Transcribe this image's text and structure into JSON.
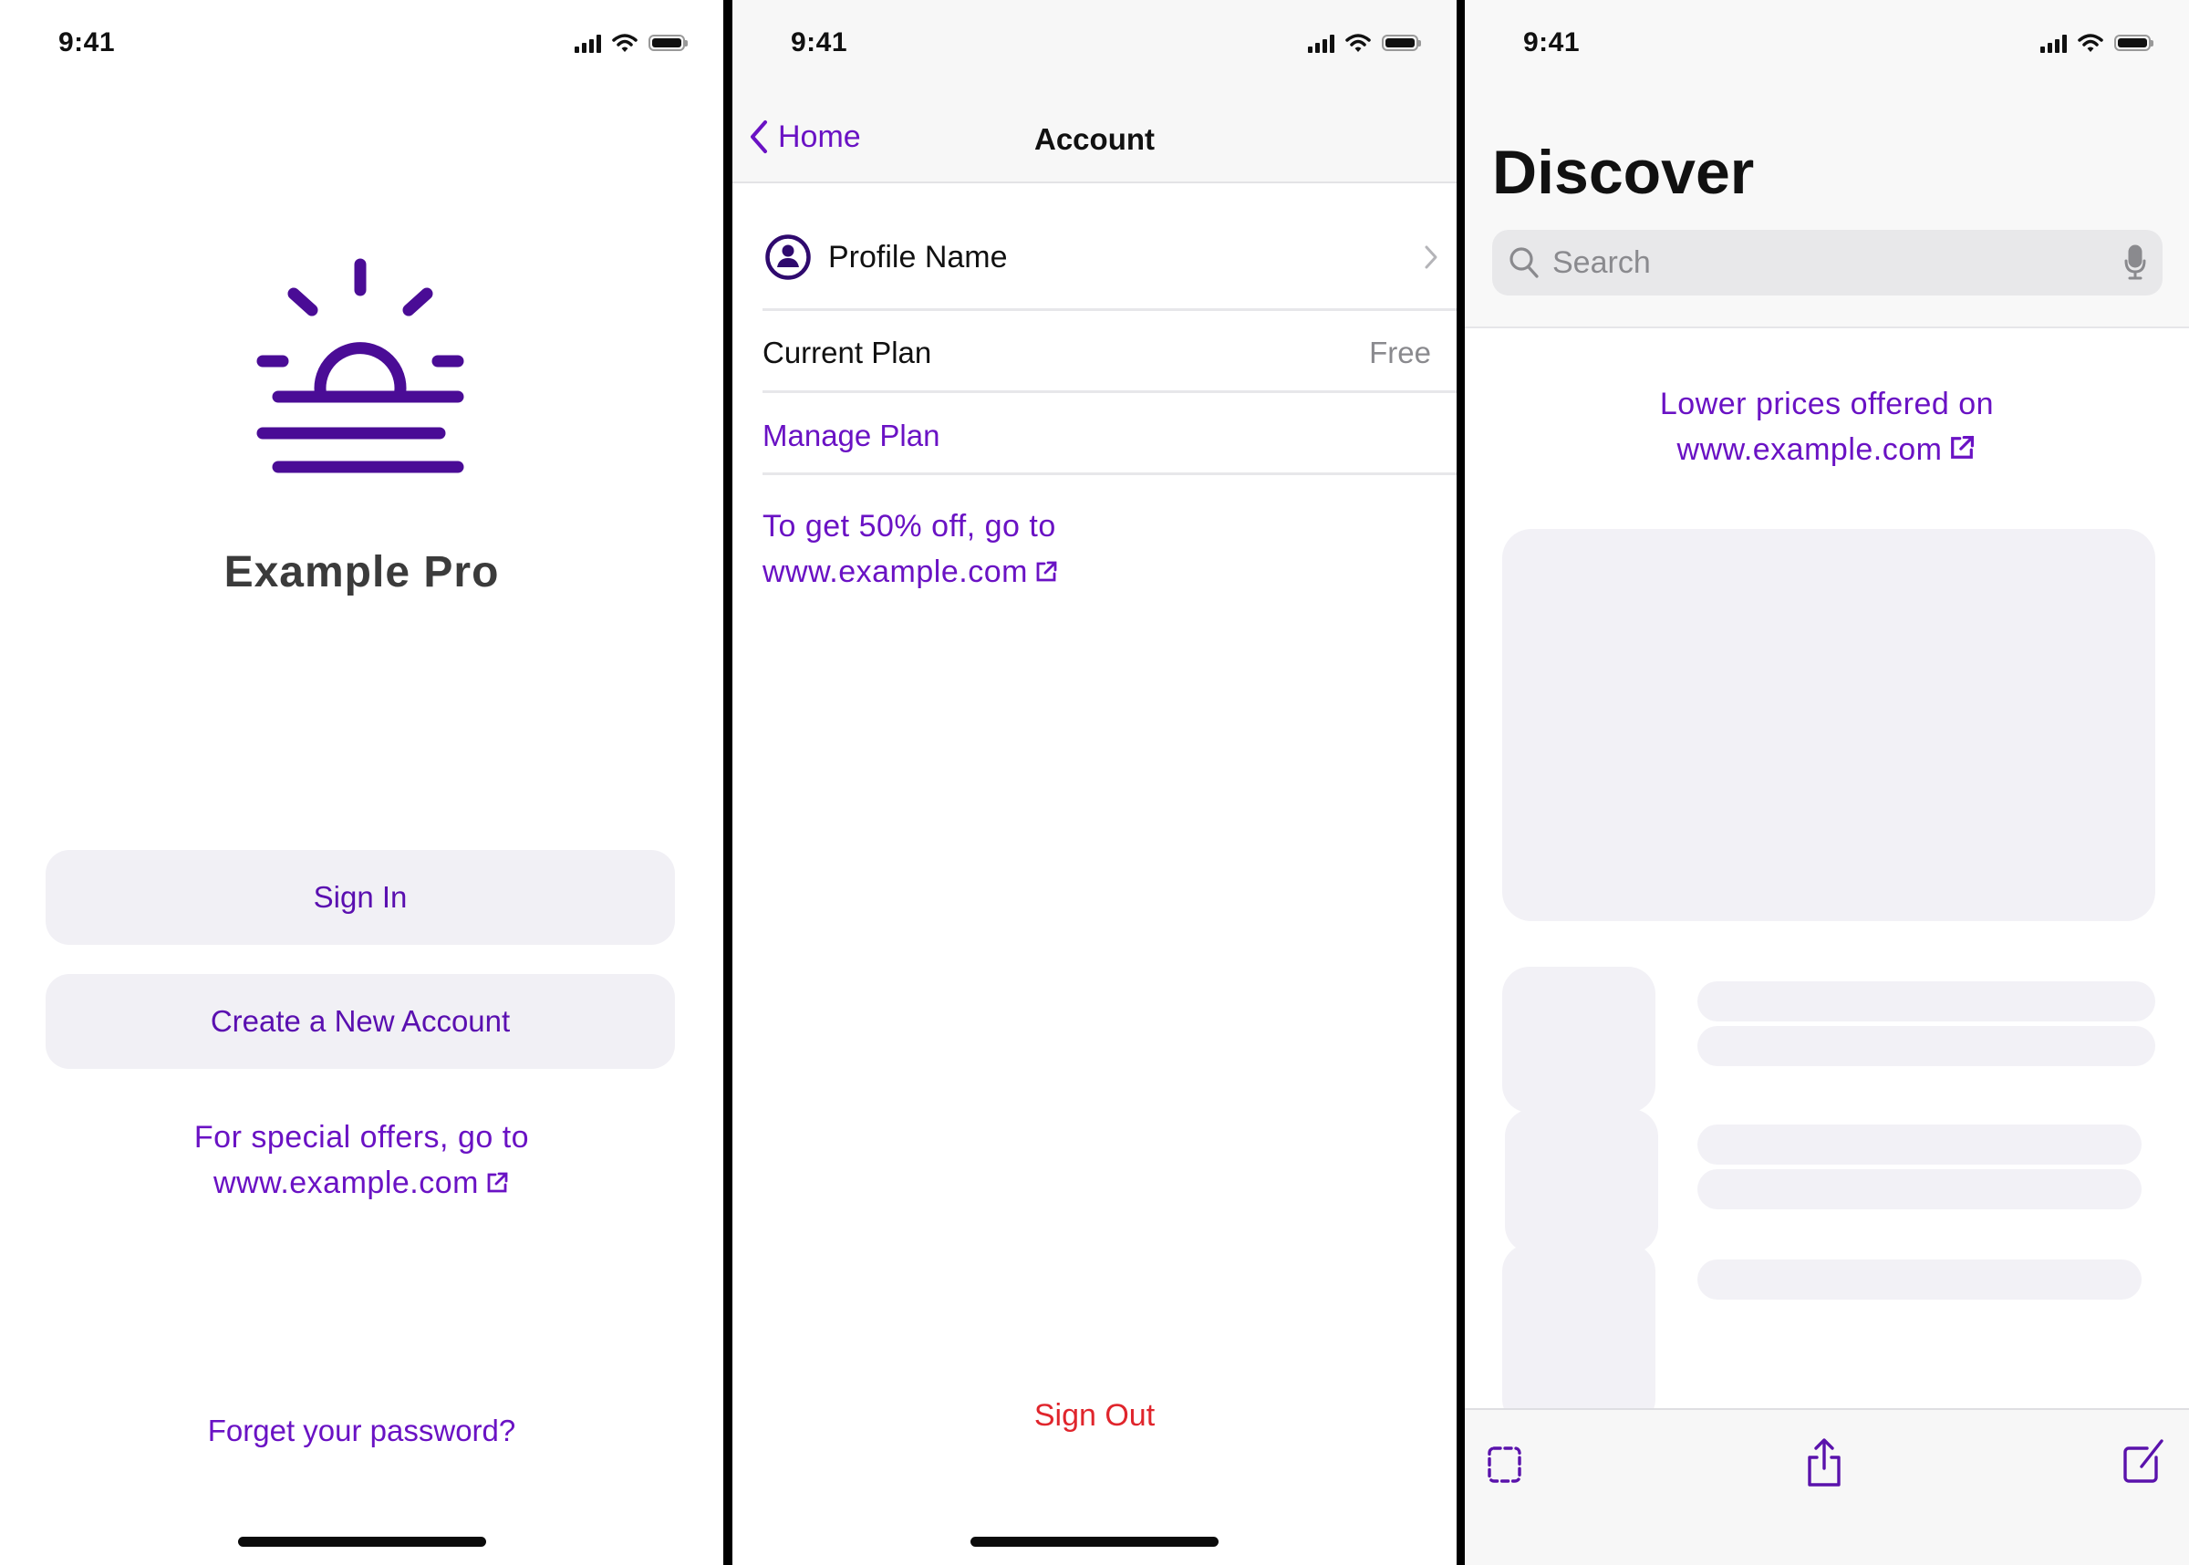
{
  "colors": {
    "accent": "#6a12c4",
    "logo": "#4a0c96",
    "destructive": "#e0252c",
    "placeholder": "#f2f1f6"
  },
  "status_bar": {
    "time": "9:41",
    "icons": [
      "signal-icon",
      "wifi-icon",
      "battery-icon"
    ]
  },
  "screen1": {
    "app_name": "Example Pro",
    "logo_icon": "sunrise-icon",
    "sign_in_label": "Sign In",
    "create_account_label": "Create a New Account",
    "promo_line1": "For special offers, go to",
    "promo_link": "www.example.com",
    "forgot_password": "Forget your password?"
  },
  "screen2": {
    "back_label": "Home",
    "title": "Account",
    "profile_name": "Profile Name",
    "current_plan_label": "Current Plan",
    "current_plan_value": "Free",
    "manage_plan_label": "Manage Plan",
    "promo_line1": "To get 50% off, go to",
    "promo_link": "www.example.com",
    "sign_out_label": "Sign Out"
  },
  "screen3": {
    "title": "Discover",
    "search_placeholder": "Search",
    "promo_line1": "Lower prices offered on",
    "promo_link": "www.example.com",
    "toolbar_icons": [
      "select-icon",
      "share-icon",
      "compose-icon"
    ]
  }
}
